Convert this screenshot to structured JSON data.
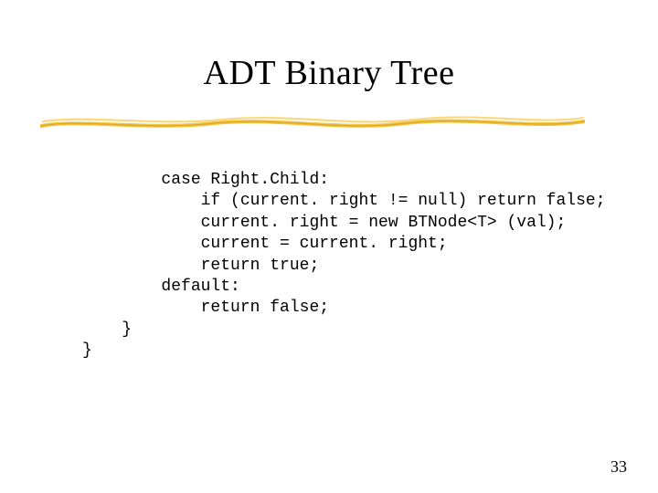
{
  "slide": {
    "title": "ADT Binary Tree",
    "page_number": "33",
    "code_lines": [
      "        case Right.Child: ",
      "            if (current. right != null) return false; ",
      "            current. right = new BTNode<T> (val); ",
      "            current = current. right; ",
      "            return true; ",
      "        default: ",
      "            return false; ",
      "    } ",
      "} "
    ]
  },
  "colors": {
    "stroke_gold": "#f2c038",
    "stroke_gold_dark": "#d9a522"
  }
}
